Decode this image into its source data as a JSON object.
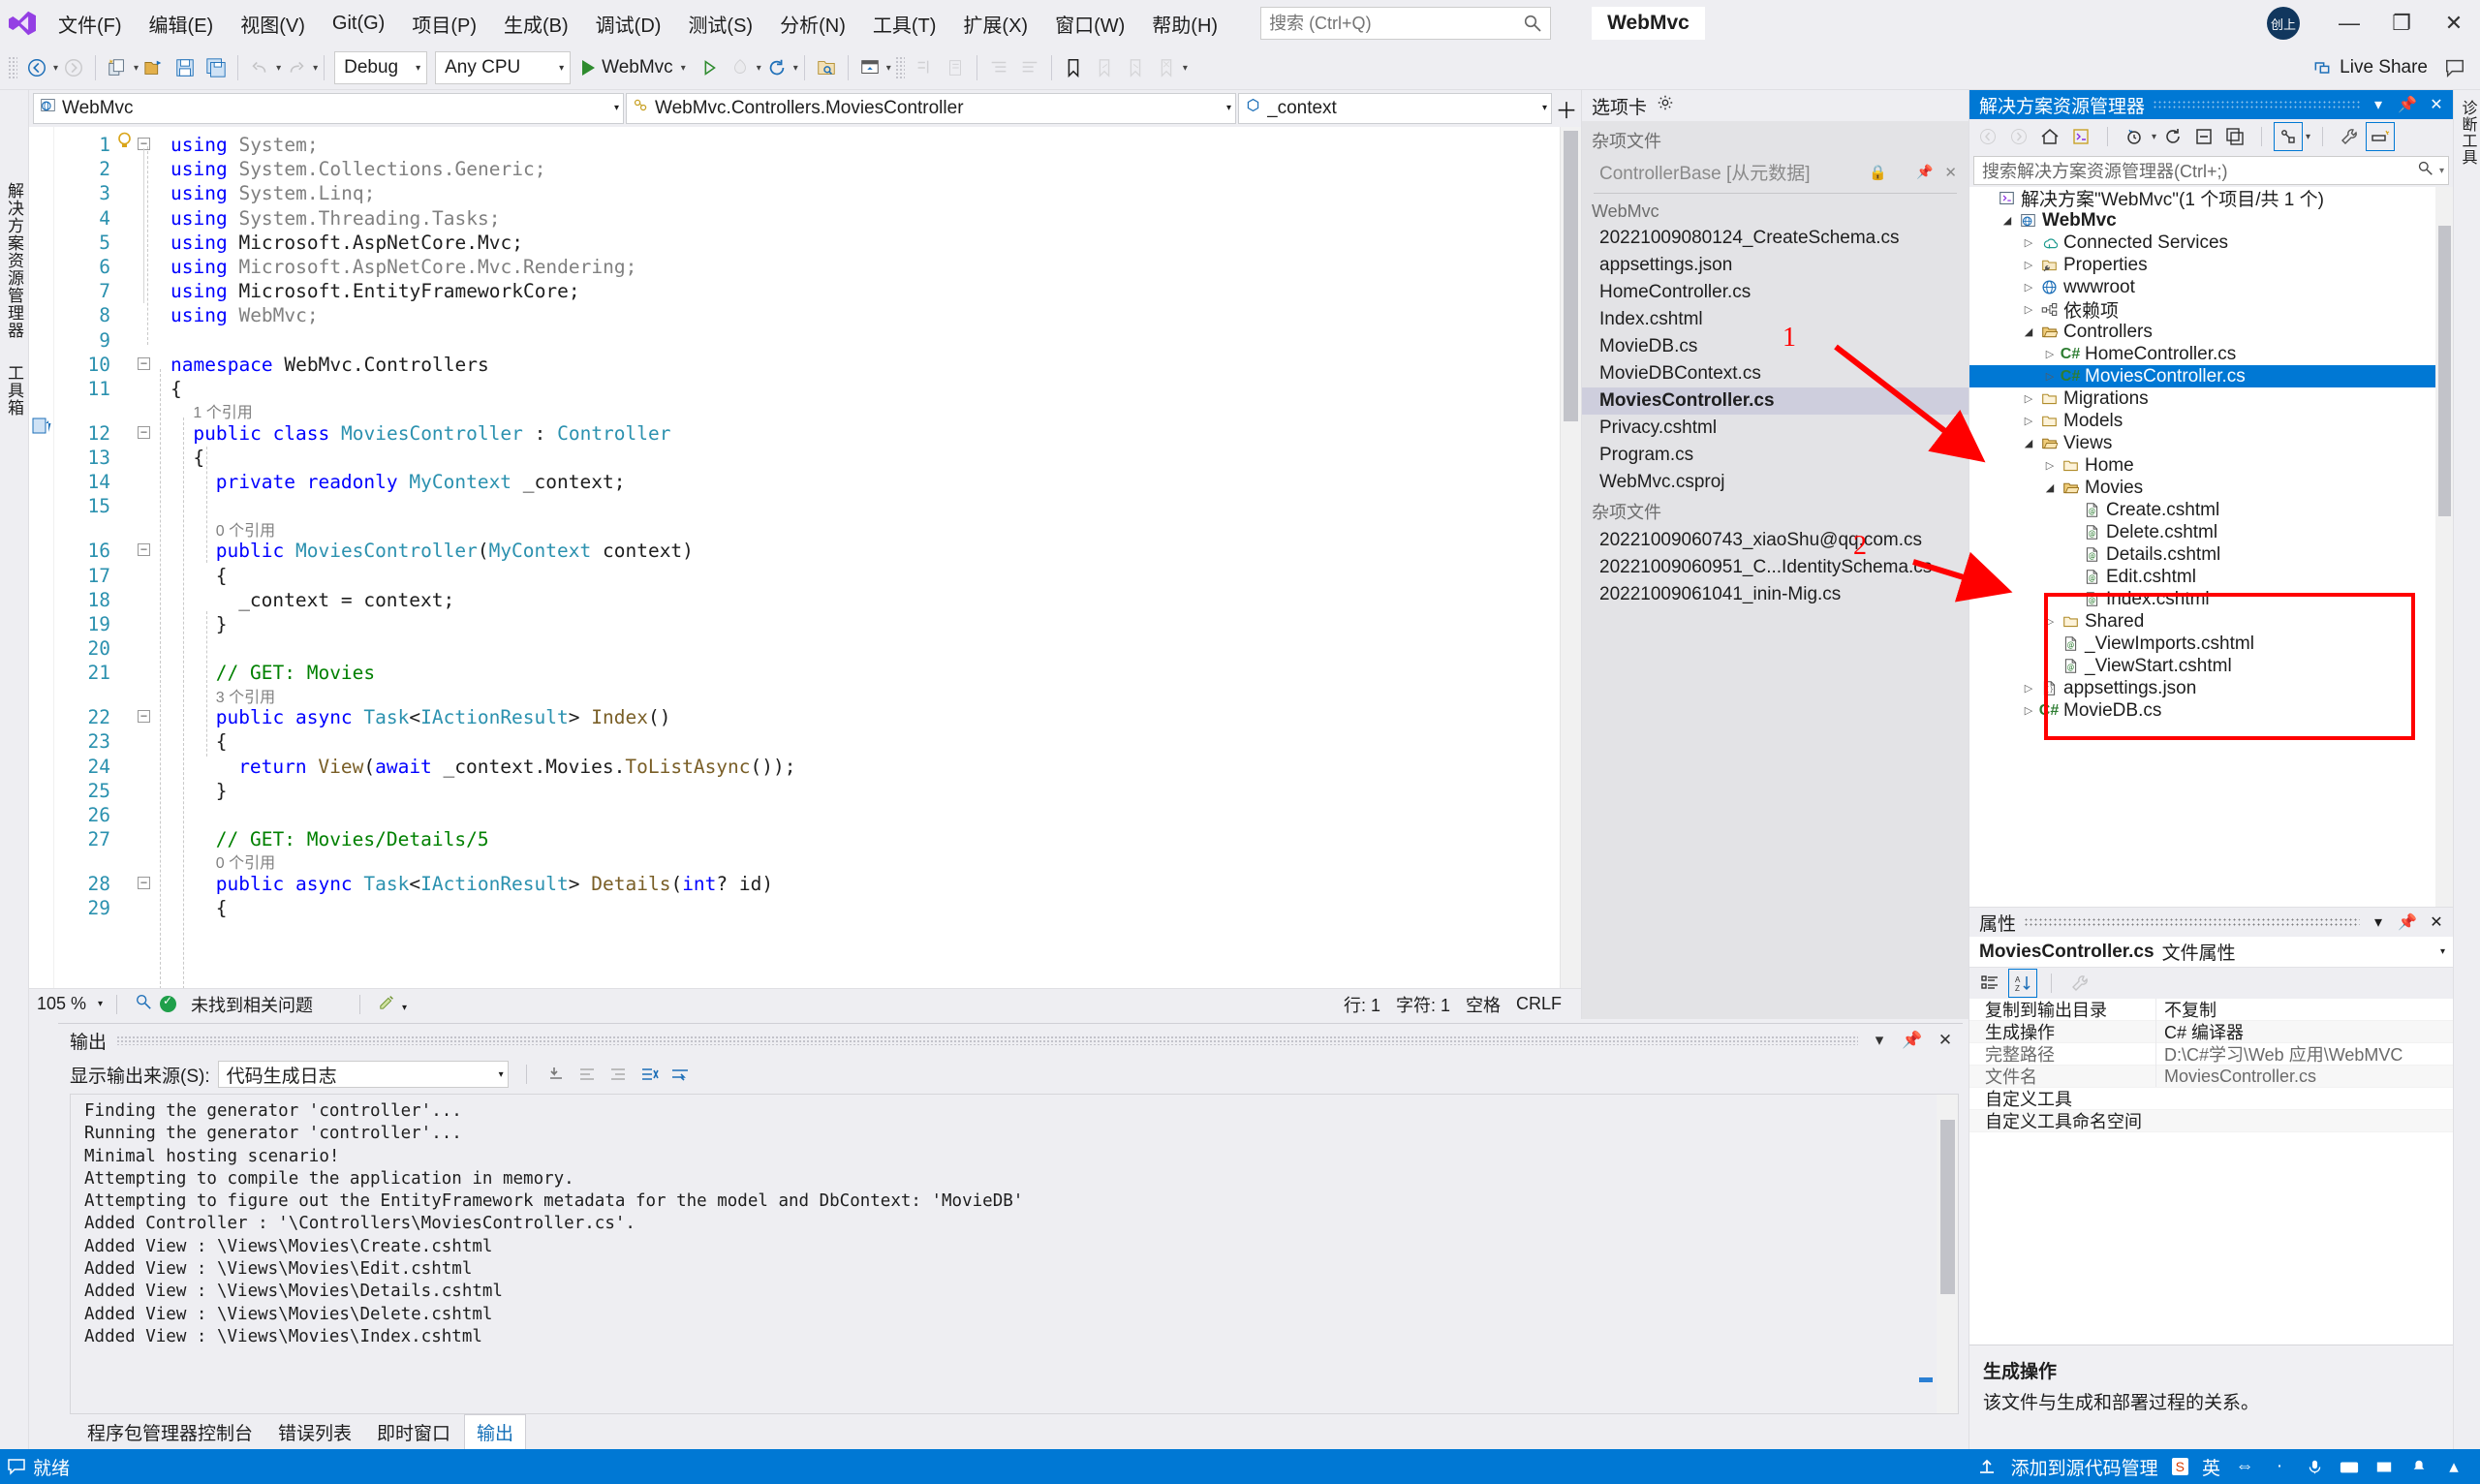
{
  "titlebar": {
    "app_icon": "visual-studio-logo",
    "menu": [
      "文件(F)",
      "编辑(E)",
      "视图(V)",
      "Git(G)",
      "项目(P)",
      "生成(B)",
      "调试(D)",
      "测试(S)",
      "分析(N)",
      "工具(T)",
      "扩展(X)",
      "窗口(W)",
      "帮助(H)"
    ],
    "search_placeholder": "搜索 (Ctrl+Q)",
    "search_icon": "search-icon",
    "solution_title": "WebMvc",
    "account_initials": "创上",
    "minimize": "—",
    "restore": "❐",
    "close": "✕"
  },
  "toolbar": {
    "nav_back_icon": "back-arrow-icon",
    "nav_fwd_icon": "forward-arrow-icon",
    "new_project_icon": "new-project-icon",
    "open_icon": "open-folder-icon",
    "save_icon": "save-icon",
    "save_all_icon": "save-all-icon",
    "undo_icon": "undo-icon",
    "redo_icon": "redo-icon",
    "configuration": "Debug",
    "platform": "Any CPU",
    "start_label": "WebMvc",
    "start_icon": "play-icon",
    "start_no_debug_icon": "play-outline-icon",
    "hot_reload_icon": "hot-reload-icon",
    "restart_icon": "restart-icon",
    "live_share_label": "Live Share",
    "live_share_icon": "live-share-icon",
    "feedback_icon": "feedback-icon"
  },
  "left_strip": {
    "tabs": [
      "解决方案资源管理器",
      "工具箱"
    ]
  },
  "navbar": {
    "project": "WebMvc",
    "project_icon": "web-project-icon",
    "type": "WebMvc.Controllers.MoviesController",
    "type_icon": "class-icon",
    "member": "_context",
    "member_icon": "field-icon",
    "add_icon": "plus-icon",
    "settings_icon": "gear-icon"
  },
  "editor": {
    "status": {
      "zoom": "105 %",
      "issues": "未找到相关问题",
      "issues_icon": "ok-check-icon",
      "magnifier_icon": "magnifier-icon",
      "pen_icon": "pen-icon",
      "line_label": "行: 1",
      "col_label": "字符: 1",
      "spaces_label": "空格",
      "eol_label": "CRLF"
    },
    "lines": [
      {
        "n": "1",
        "indent": 0,
        "fold": "minus",
        "bulb": true,
        "tokens": [
          [
            "k",
            "using "
          ],
          [
            "g",
            "System;"
          ]
        ]
      },
      {
        "n": "2",
        "indent": 0,
        "tokens": [
          [
            "k",
            "using "
          ],
          [
            "g",
            "System.Collections.Generic;"
          ]
        ]
      },
      {
        "n": "3",
        "indent": 0,
        "tokens": [
          [
            "k",
            "using "
          ],
          [
            "g",
            "System.Linq;"
          ]
        ]
      },
      {
        "n": "4",
        "indent": 0,
        "tokens": [
          [
            "k",
            "using "
          ],
          [
            "g",
            "System.Threading.Tasks;"
          ]
        ]
      },
      {
        "n": "5",
        "indent": 0,
        "tokens": [
          [
            "k",
            "using "
          ],
          [
            "n",
            "Microsoft.AspNetCore.Mvc;"
          ]
        ]
      },
      {
        "n": "6",
        "indent": 0,
        "tokens": [
          [
            "k",
            "using "
          ],
          [
            "g",
            "Microsoft.AspNetCore.Mvc.Rendering;"
          ]
        ]
      },
      {
        "n": "7",
        "indent": 0,
        "tokens": [
          [
            "k",
            "using "
          ],
          [
            "n",
            "Microsoft.EntityFrameworkCore;"
          ]
        ]
      },
      {
        "n": "8",
        "indent": 0,
        "tokens": [
          [
            "k",
            "using "
          ],
          [
            "g",
            "WebMvc;"
          ]
        ]
      },
      {
        "n": "9",
        "indent": 0,
        "tokens": []
      },
      {
        "n": "10",
        "indent": 0,
        "fold": "minus",
        "tokens": [
          [
            "k",
            "namespace "
          ],
          [
            "n",
            "WebMvc.Controllers"
          ]
        ]
      },
      {
        "n": "11",
        "indent": 0,
        "tokens": [
          [
            "n",
            "{"
          ]
        ]
      },
      {
        "n": "12",
        "indent": 2,
        "fold": "minus",
        "codelens": "1 个引用",
        "mark": "changes",
        "tokens": [
          [
            "k",
            "public class "
          ],
          [
            "ty",
            "MoviesController"
          ],
          [
            "n",
            " : "
          ],
          [
            "ty",
            "Controller"
          ]
        ]
      },
      {
        "n": "13",
        "indent": 2,
        "tokens": [
          [
            "n",
            "{"
          ]
        ]
      },
      {
        "n": "14",
        "indent": 4,
        "tokens": [
          [
            "k",
            "private readonly "
          ],
          [
            "ty",
            "MyContext"
          ],
          [
            "n",
            " _context;"
          ]
        ]
      },
      {
        "n": "15",
        "indent": 0,
        "tokens": []
      },
      {
        "n": "16",
        "indent": 4,
        "fold": "minus",
        "codelens": "0 个引用",
        "tokens": [
          [
            "k",
            "public "
          ],
          [
            "ty",
            "MoviesController"
          ],
          [
            "n",
            "("
          ],
          [
            "ty",
            "MyContext"
          ],
          [
            "n",
            " context)"
          ]
        ]
      },
      {
        "n": "17",
        "indent": 4,
        "tokens": [
          [
            "n",
            "{"
          ]
        ]
      },
      {
        "n": "18",
        "indent": 6,
        "tokens": [
          [
            "n",
            "_context = context;"
          ]
        ]
      },
      {
        "n": "19",
        "indent": 4,
        "tokens": [
          [
            "n",
            "}"
          ]
        ]
      },
      {
        "n": "20",
        "indent": 0,
        "tokens": []
      },
      {
        "n": "21",
        "indent": 4,
        "tokens": [
          [
            "c",
            "// GET: Movies"
          ]
        ]
      },
      {
        "n": "22",
        "indent": 4,
        "fold": "minus",
        "codelens": "3 个引用",
        "tokens": [
          [
            "k",
            "public async "
          ],
          [
            "ty",
            "Task"
          ],
          [
            "n",
            "<"
          ],
          [
            "ty",
            "IActionResult"
          ],
          [
            "n",
            "> "
          ],
          [
            "m",
            "Index"
          ],
          [
            "n",
            "()"
          ]
        ]
      },
      {
        "n": "23",
        "indent": 4,
        "tokens": [
          [
            "n",
            "{"
          ]
        ]
      },
      {
        "n": "24",
        "indent": 6,
        "tokens": [
          [
            "k",
            "return "
          ],
          [
            "m",
            "View"
          ],
          [
            "n",
            "("
          ],
          [
            "k",
            "await "
          ],
          [
            "n",
            "_context.Movies."
          ],
          [
            "m",
            "ToListAsync"
          ],
          [
            "n",
            "());"
          ]
        ]
      },
      {
        "n": "25",
        "indent": 4,
        "tokens": [
          [
            "n",
            "}"
          ]
        ]
      },
      {
        "n": "26",
        "indent": 0,
        "tokens": []
      },
      {
        "n": "27",
        "indent": 4,
        "tokens": [
          [
            "c",
            "// GET: Movies/Details/5"
          ]
        ]
      },
      {
        "n": "28",
        "indent": 4,
        "fold": "minus",
        "codelens": "0 个引用",
        "tokens": [
          [
            "k",
            "public async "
          ],
          [
            "ty",
            "Task"
          ],
          [
            "n",
            "<"
          ],
          [
            "ty",
            "IActionResult"
          ],
          [
            "n",
            "> "
          ],
          [
            "m",
            "Details"
          ],
          [
            "n",
            "("
          ],
          [
            "k",
            "int"
          ],
          [
            "n",
            "? id)"
          ]
        ]
      },
      {
        "n": "29",
        "indent": 4,
        "tokens": [
          [
            "n",
            "{"
          ]
        ]
      }
    ]
  },
  "midpanel": {
    "title": "选项卡",
    "gear_icon": "gear-icon",
    "groups": [
      {
        "name": "杂项文件",
        "items": [
          {
            "label": "ControllerBase [从元数据]",
            "dim": true,
            "lock_icon": "lock-icon",
            "pin_icon": "pin-icon",
            "close_icon": "close-icon"
          }
        ],
        "divider": true
      },
      {
        "name": "WebMvc",
        "items": [
          {
            "label": "20221009080124_CreateSchema.cs"
          },
          {
            "label": "appsettings.json"
          },
          {
            "label": "HomeController.cs"
          },
          {
            "label": "Index.cshtml"
          },
          {
            "label": "MovieDB.cs"
          },
          {
            "label": "MovieDBContext.cs"
          },
          {
            "label": "MoviesController.cs",
            "selected": true
          },
          {
            "label": "Privacy.cshtml"
          },
          {
            "label": "Program.cs"
          },
          {
            "label": "WebMvc.csproj"
          }
        ]
      },
      {
        "name": "杂项文件",
        "items": [
          {
            "label": "20221009060743_xiaoShu@qq.com.cs"
          },
          {
            "label": "20221009060951_C...IdentitySchema.cs"
          },
          {
            "label": "20221009061041_inin-Mig.cs"
          }
        ]
      }
    ]
  },
  "output": {
    "title": "输出",
    "minimize_icon": "minimize-icon",
    "pin_icon": "pin-icon",
    "close_icon": "close-icon",
    "source_label": "显示输出来源(S):",
    "source_value": "代码生成日志",
    "tool_icons": [
      "clear-all-icon",
      "wrap-line-icon",
      "unwrap-line-icon",
      "clear-pane-icon",
      "toggle-wordwrap-icon"
    ],
    "lines": [
      "Finding the generator 'controller'...",
      "Running the generator 'controller'...",
      "Minimal hosting scenario!",
      "Attempting to compile the application in memory.",
      "Attempting to figure out the EntityFramework metadata for the model and DbContext: 'MovieDB'",
      "Added Controller : '\\Controllers\\MoviesController.cs'.",
      "Added View : \\Views\\Movies\\Create.cshtml",
      "Added View : \\Views\\Movies\\Edit.cshtml",
      "Added View : \\Views\\Movies\\Details.cshtml",
      "Added View : \\Views\\Movies\\Delete.cshtml",
      "Added View : \\Views\\Movies\\Index.cshtml"
    ],
    "tabs": [
      {
        "label": "程序包管理器控制台",
        "active": false
      },
      {
        "label": "错误列表",
        "active": false
      },
      {
        "label": "即时窗口",
        "active": false
      },
      {
        "label": "输出",
        "active": true
      }
    ]
  },
  "solution_explorer": {
    "title": "解决方案资源管理器",
    "dropdown_icon": "chevron-down-icon",
    "pin_icon": "pin-icon",
    "close_icon": "close-icon",
    "toolbar_icons": [
      "back-arrow-icon",
      "forward-arrow-icon",
      "home-icon",
      "solution-view-icon",
      "pending-changes-icon",
      "refresh-icon",
      "collapse-all-icon",
      "show-all-files-icon",
      "view-class-diagram-icon",
      "properties-wrench-icon",
      "preview-selected-items-icon"
    ],
    "search_placeholder": "搜索解决方案资源管理器(Ctrl+;)",
    "search_icon": "search-icon",
    "tree": [
      {
        "label": "解决方案\"WebMvc\"(1 个项目/共 1 个)",
        "depth": 0,
        "icon": "solution-icon",
        "arrow": "none"
      },
      {
        "label": "WebMvc",
        "depth": 1,
        "icon": "web-project-icon",
        "arrow": "open",
        "bold": true
      },
      {
        "label": "Connected Services",
        "depth": 2,
        "icon": "connected-services-icon",
        "arrow": "closed"
      },
      {
        "label": "Properties",
        "depth": 2,
        "icon": "properties-folder-icon",
        "arrow": "closed"
      },
      {
        "label": "wwwroot",
        "depth": 2,
        "icon": "wwwroot-icon",
        "arrow": "closed"
      },
      {
        "label": "依赖项",
        "depth": 2,
        "icon": "dependencies-icon",
        "arrow": "closed"
      },
      {
        "label": "Controllers",
        "depth": 2,
        "icon": "folder-open-icon",
        "arrow": "open"
      },
      {
        "label": "HomeController.cs",
        "depth": 3,
        "icon": "csharp-file-icon",
        "arrow": "closed"
      },
      {
        "label": "MoviesController.cs",
        "depth": 3,
        "icon": "csharp-file-icon",
        "arrow": "closed",
        "selected": true
      },
      {
        "label": "Migrations",
        "depth": 2,
        "icon": "folder-icon",
        "arrow": "closed"
      },
      {
        "label": "Models",
        "depth": 2,
        "icon": "folder-icon",
        "arrow": "closed"
      },
      {
        "label": "Views",
        "depth": 2,
        "icon": "folder-open-icon",
        "arrow": "open"
      },
      {
        "label": "Home",
        "depth": 3,
        "icon": "folder-icon",
        "arrow": "closed"
      },
      {
        "label": "Movies",
        "depth": 3,
        "icon": "folder-open-icon",
        "arrow": "open"
      },
      {
        "label": "Create.cshtml",
        "depth": 4,
        "icon": "razor-file-icon",
        "arrow": "none"
      },
      {
        "label": "Delete.cshtml",
        "depth": 4,
        "icon": "razor-file-icon",
        "arrow": "none"
      },
      {
        "label": "Details.cshtml",
        "depth": 4,
        "icon": "razor-file-icon",
        "arrow": "none"
      },
      {
        "label": "Edit.cshtml",
        "depth": 4,
        "icon": "razor-file-icon",
        "arrow": "none"
      },
      {
        "label": "Index.cshtml",
        "depth": 4,
        "icon": "razor-file-icon",
        "arrow": "none"
      },
      {
        "label": "Shared",
        "depth": 3,
        "icon": "folder-icon",
        "arrow": "closed"
      },
      {
        "label": "_ViewImports.cshtml",
        "depth": 3,
        "icon": "razor-file-icon",
        "arrow": "none"
      },
      {
        "label": "_ViewStart.cshtml",
        "depth": 3,
        "icon": "razor-file-icon",
        "arrow": "none"
      },
      {
        "label": "appsettings.json",
        "depth": 2,
        "icon": "json-file-icon",
        "arrow": "closed"
      },
      {
        "label": "MovieDB.cs",
        "depth": 2,
        "icon": "csharp-file-icon",
        "arrow": "closed"
      }
    ]
  },
  "properties": {
    "title": "属性",
    "dropdown_icon": "chevron-down-icon",
    "pin_icon": "pin-icon",
    "close_icon": "close-icon",
    "object_name": "MoviesController.cs",
    "object_kind": "文件属性",
    "object_dropdown_icon": "chevron-down-icon",
    "toolbar_icons": [
      "categorized-icon",
      "alphabetical-icon",
      "property-pages-icon"
    ],
    "rows": [
      {
        "name": "复制到输出目录",
        "value": "不复制",
        "dim": false
      },
      {
        "name": "生成操作",
        "value": "C# 编译器",
        "dim": false
      },
      {
        "name": "完整路径",
        "value": "D:\\C#学习\\Web 应用\\WebMVC",
        "dim": true
      },
      {
        "name": "文件名",
        "value": "MoviesController.cs",
        "dim": true
      },
      {
        "name": "自定义工具",
        "value": "",
        "dim": false
      },
      {
        "name": "自定义工具命名空间",
        "value": "",
        "dim": false
      }
    ],
    "desc_title": "生成操作",
    "desc_body": "该文件与生成和部署过程的关系。"
  },
  "right_strip": {
    "tabs": [
      "诊断工具"
    ]
  },
  "statusbar": {
    "ready_icon": "notify-icon",
    "ready": "就绪",
    "add_to_source_control_icon": "upload-icon",
    "add_to_source_control": "添加到源代码管理",
    "ime_badge": "S",
    "language": "英",
    "icons": [
      "half-width-icon",
      "dot-icon",
      "mic-icon",
      "keyboard-icon",
      "tray-icon",
      "bell-icon",
      "chevron-up-icon"
    ]
  },
  "annotations": [
    {
      "id": "1",
      "label": "1"
    },
    {
      "id": "2",
      "label": "2"
    }
  ]
}
